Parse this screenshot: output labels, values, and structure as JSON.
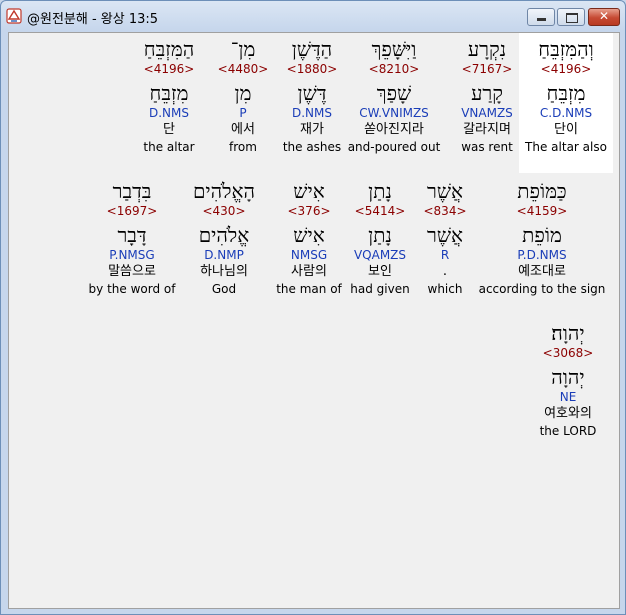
{
  "window": {
    "title": "@원전분해 - 왕상 13:5"
  },
  "rows": [
    [
      {
        "heb": "וְהַמִּזְבֵּחַ",
        "strong": "<4196>",
        "lemma": "מִזְבֵּחַ",
        "parse": "C.D.NMS",
        "korean": "단이",
        "english": "The altar also",
        "highlight": true
      },
      {
        "heb": "נִקְרָע",
        "strong": "<7167>",
        "lemma": "קָרַע",
        "parse": "VNAMZS",
        "korean": "갈라지며",
        "english": "was rent"
      },
      {
        "heb": "וַיִּשָּׁפֵךְ",
        "strong": "<8210>",
        "lemma": "שָׁפַךְ",
        "parse": "CW.VNIMZS",
        "korean": "쏟아진지라",
        "english": "and-poured out"
      },
      {
        "heb": "הַדֶּשֶׁן",
        "strong": "<1880>",
        "lemma": "דֶּשֶׁן",
        "parse": "D.NMS",
        "korean": "재가",
        "english": "the ashes"
      },
      {
        "heb": "מִן־",
        "strong": "<4480>",
        "lemma": "מִן",
        "parse": "P",
        "korean": "에서",
        "english": "from"
      },
      {
        "heb": "הַמִּזְבֵּחַ",
        "strong": "<4196>",
        "lemma": "מִזְבֵּחַ",
        "parse": "D.NMS",
        "korean": "단",
        "english": "the altar"
      }
    ],
    [
      {
        "heb": "כַּמּוֹפֵת",
        "strong": "<4159>",
        "lemma": "מוֹפֵת",
        "parse": "P.D.NMS",
        "korean": "예조대로",
        "english": "according to the sign"
      },
      {
        "heb": "אֲשֶׁר",
        "strong": "<834>",
        "lemma": "אֲשֶׁר",
        "parse": "R",
        "korean": ".",
        "english": "which"
      },
      {
        "heb": "נָתַן",
        "strong": "<5414>",
        "lemma": "נָתַן",
        "parse": "VQAMZS",
        "korean": "보인",
        "english": "had given"
      },
      {
        "heb": "אִישׁ",
        "strong": "<376>",
        "lemma": "אִישׁ",
        "parse": "NMSG",
        "korean": "사람의",
        "english": "the man of"
      },
      {
        "heb": "הָאֱלֹהִים",
        "strong": "<430>",
        "lemma": "אֱלֹהִים",
        "parse": "D.NMP",
        "korean": "하나님의",
        "english": "God"
      },
      {
        "heb": "בִּדְבַר",
        "strong": "<1697>",
        "lemma": "דָּבָר",
        "parse": "P.NMSG",
        "korean": "말씀으로",
        "english": "by the word of"
      }
    ],
    [
      {
        "heb": "יְהוָה׃",
        "strong": "<3068>",
        "lemma": "יְהוָה",
        "parse": "NE",
        "korean": "여호와의",
        "english": "the LORD"
      }
    ]
  ]
}
